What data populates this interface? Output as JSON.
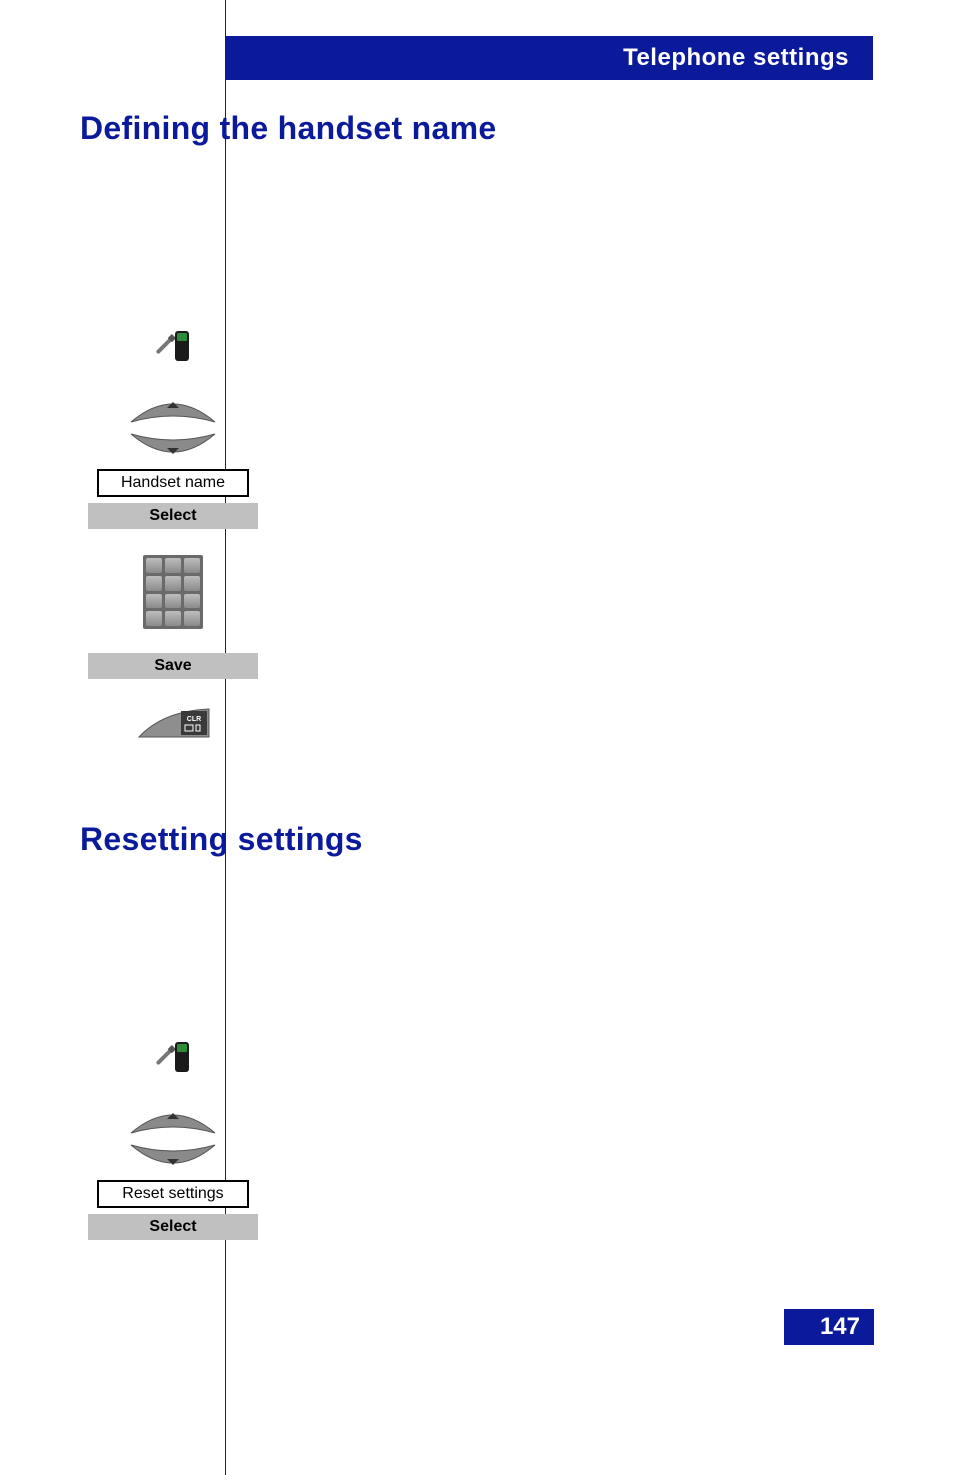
{
  "header": {
    "title": "Telephone settings"
  },
  "page_number": "147",
  "sections": {
    "defining": {
      "title": "Defining the handset name",
      "display_label": "Handset name",
      "select_label": "Select",
      "save_label": "Save",
      "clr_label": "CLR"
    },
    "resetting": {
      "title": "Resetting settings",
      "display_label": "Reset settings",
      "select_label": "Select"
    }
  }
}
